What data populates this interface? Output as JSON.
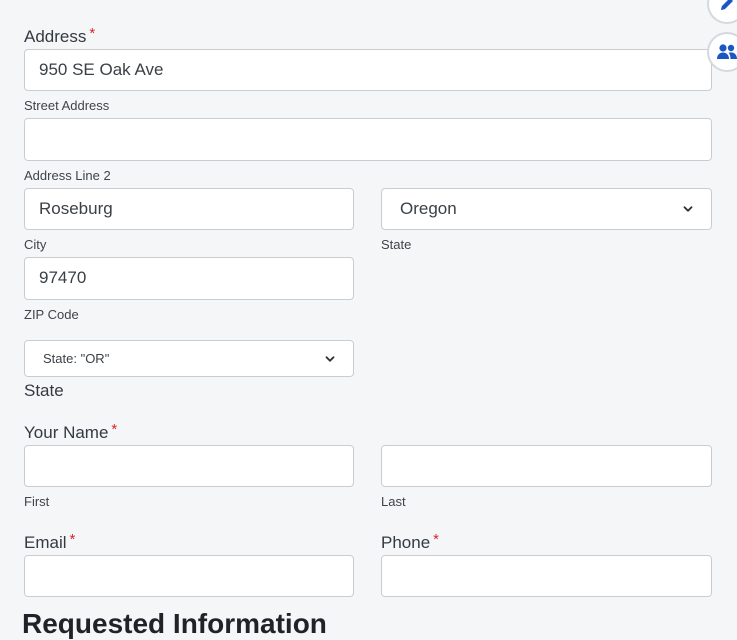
{
  "address": {
    "label": "Address",
    "required_mark": "*",
    "street_value": "950 SE Oak Ave",
    "street_label": "Street Address",
    "line2_value": "",
    "line2_label": "Address Line 2",
    "city_value": "Roseburg",
    "city_label": "City",
    "state_value": "Oregon",
    "state_label": "State",
    "zip_value": "97470",
    "zip_label": "ZIP Code"
  },
  "state_select": {
    "value": "State: \"OR\"",
    "label": "State"
  },
  "name": {
    "label": "Your Name",
    "required_mark": "*",
    "first_value": "",
    "first_label": "First",
    "last_value": "",
    "last_label": "Last"
  },
  "email": {
    "label": "Email",
    "required_mark": "*",
    "value": ""
  },
  "phone": {
    "label": "Phone",
    "required_mark": "*",
    "value": ""
  },
  "next_section": {
    "title": "Requested Information"
  },
  "side_buttons": {
    "edit_icon": "pencil-icon",
    "users_icon": "users-icon",
    "accent": "#1a56c4"
  },
  "colors": {
    "required": "#d9262a",
    "background": "#f5f6f8",
    "border": "#c9cdd2"
  }
}
